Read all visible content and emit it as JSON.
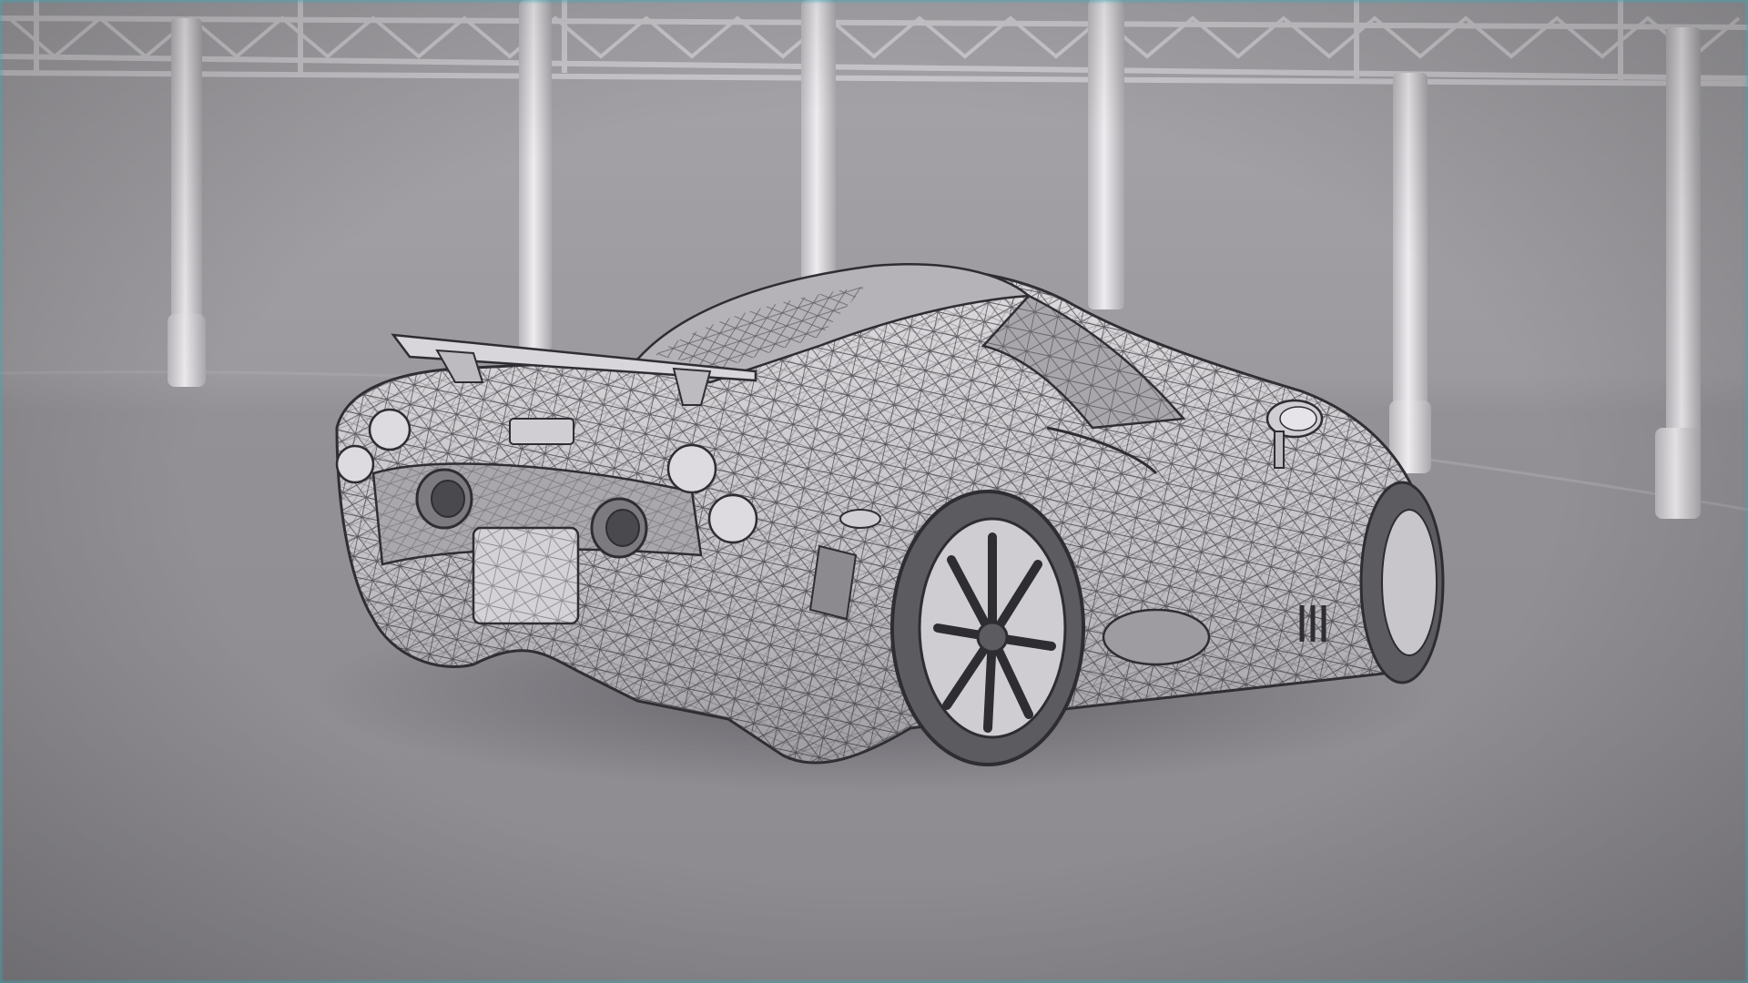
{
  "scene": {
    "subject": "car-wireframe",
    "colors": {
      "background_top": "#a3a1a5",
      "background_floor": "#8f8d92",
      "truss": "#c9c7cb",
      "pillar": "#d6d4d8",
      "car_body": "#cfcdd1",
      "car_shadow": "#6f6d72",
      "wire": "#3a393d",
      "edge_tint": "#3cabb9"
    }
  }
}
